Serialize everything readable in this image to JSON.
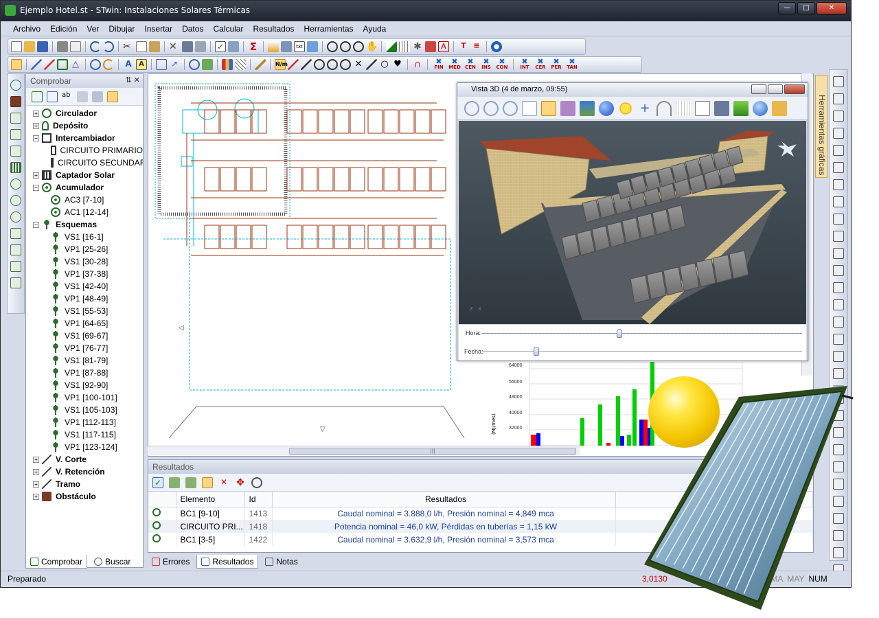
{
  "window": {
    "title": "Ejemplo Hotel.st - STwin: Instalaciones Solares Térmicas",
    "controls": [
      "minimize",
      "maximize",
      "close"
    ]
  },
  "menu": [
    "Archivo",
    "Edición",
    "Ver",
    "Dibujar",
    "Insertar",
    "Datos",
    "Calcular",
    "Resultados",
    "Herramientas",
    "Ayuda"
  ],
  "toolbar3_labels": [
    "FIN",
    "MED",
    "CEN",
    "INS",
    "CON",
    "INT",
    "CER",
    "PER",
    "TAN"
  ],
  "tree_panel": {
    "title": "Comprobar",
    "items": [
      {
        "label": "Circulador",
        "level": 0,
        "icon": "pump-icon"
      },
      {
        "label": "Depósito",
        "level": 0,
        "icon": "tank-icon"
      },
      {
        "label": "Intercambiador",
        "level": 0,
        "icon": "exchanger-icon",
        "expanded": true
      },
      {
        "label": "CIRCUITO PRIMARIO",
        "level": 1,
        "icon": "exchanger-icon"
      },
      {
        "label": "CIRCUITO SECUNDARIO",
        "level": 1,
        "icon": "exchanger-icon"
      },
      {
        "label": "Captador Solar",
        "level": 0,
        "icon": "collector-icon"
      },
      {
        "label": "Acumulador",
        "level": 0,
        "icon": "accumulator-icon",
        "expanded": true
      },
      {
        "label": "AC3 [7-10]",
        "level": 1,
        "icon": "accumulator-icon"
      },
      {
        "label": "AC1 [12-14]",
        "level": 1,
        "icon": "accumulator-icon"
      },
      {
        "label": "Esquemas",
        "level": 0,
        "icon": "valve-icon",
        "expanded": true
      },
      {
        "label": "VS1 [16-1]",
        "level": 1,
        "icon": "valve-icon"
      },
      {
        "label": "VP1 [25-26]",
        "level": 1,
        "icon": "valve-icon"
      },
      {
        "label": "VS1 [30-28]",
        "level": 1,
        "icon": "valve-icon"
      },
      {
        "label": "VP1 [37-38]",
        "level": 1,
        "icon": "valve-icon"
      },
      {
        "label": "VS1 [42-40]",
        "level": 1,
        "icon": "valve-icon"
      },
      {
        "label": "VP1 [48-49]",
        "level": 1,
        "icon": "valve-icon"
      },
      {
        "label": "VS1 [55-53]",
        "level": 1,
        "icon": "valve-icon"
      },
      {
        "label": "VP1 [64-65]",
        "level": 1,
        "icon": "valve-icon"
      },
      {
        "label": "VS1 [69-67]",
        "level": 1,
        "icon": "valve-icon"
      },
      {
        "label": "VP1 [76-77]",
        "level": 1,
        "icon": "valve-icon"
      },
      {
        "label": "VS1 [81-79]",
        "level": 1,
        "icon": "valve-icon"
      },
      {
        "label": "VP1 [87-88]",
        "level": 1,
        "icon": "valve-icon"
      },
      {
        "label": "VS1 [92-90]",
        "level": 1,
        "icon": "valve-icon"
      },
      {
        "label": "VP1 [100-101]",
        "level": 1,
        "icon": "valve-icon"
      },
      {
        "label": "VS1 [105-103]",
        "level": 1,
        "icon": "valve-icon"
      },
      {
        "label": "VP1 [112-113]",
        "level": 1,
        "icon": "valve-icon"
      },
      {
        "label": "VS1 [117-115]",
        "level": 1,
        "icon": "valve-icon"
      },
      {
        "label": "VP1 [123-124]",
        "level": 1,
        "icon": "valve-icon"
      },
      {
        "label": "V. Corte",
        "level": 0,
        "icon": "line-icon"
      },
      {
        "label": "V. Retención",
        "level": 0,
        "icon": "line-icon"
      },
      {
        "label": "Tramo",
        "level": 0,
        "icon": "line-icon"
      },
      {
        "label": "Obstáculo",
        "level": 0,
        "icon": "obstacle-icon"
      }
    ],
    "tabs": [
      "Comprobar",
      "Buscar"
    ]
  },
  "results_panel": {
    "title": "Resultados",
    "columns": [
      "Elemento",
      "Id",
      "Resultados"
    ],
    "rows": [
      {
        "element": "BC1 [9-10]",
        "id": "1413",
        "result": "Caudal nominal = 3.888,0 l/h, Presión nominal = 4,849 mca"
      },
      {
        "element": "CIRCUITO PRI...",
        "id": "1418",
        "result": "Potencia nominal = 46,0 kW, Pérdidas en tuberías = 1,15 kW"
      },
      {
        "element": "BC1 [3-5]",
        "id": "1422",
        "result": "Caudal nominal = 3.632,9 l/h, Presión nominal = 3,573 mca"
      }
    ],
    "tabs": [
      "Errores",
      "Resultados",
      "Notas"
    ]
  },
  "vista3d": {
    "title": "Vista 3D (4 de marzo, 09:55)",
    "hora_label": "Hora:",
    "fecha_label": "Fecha:",
    "hora_value": 0.43,
    "fecha_value": 0.17
  },
  "right_tab": {
    "label": "Herramientas gráficas"
  },
  "chart_fragment": {
    "y_ticks": [
      "64000",
      "56000",
      "48000",
      "40000",
      "32000"
    ],
    "y_unit": "(MJ/mes)"
  },
  "statusbar": {
    "ready": "Preparado",
    "coordinate": "3,0130",
    "keys": [
      "IMA",
      "MAY",
      "NUM"
    ]
  },
  "colors": {
    "pipe": "#9a3412",
    "cad_cyan": "#00b7d8",
    "accent_blue": "#1a3fa0",
    "sun": "#ffd400"
  }
}
